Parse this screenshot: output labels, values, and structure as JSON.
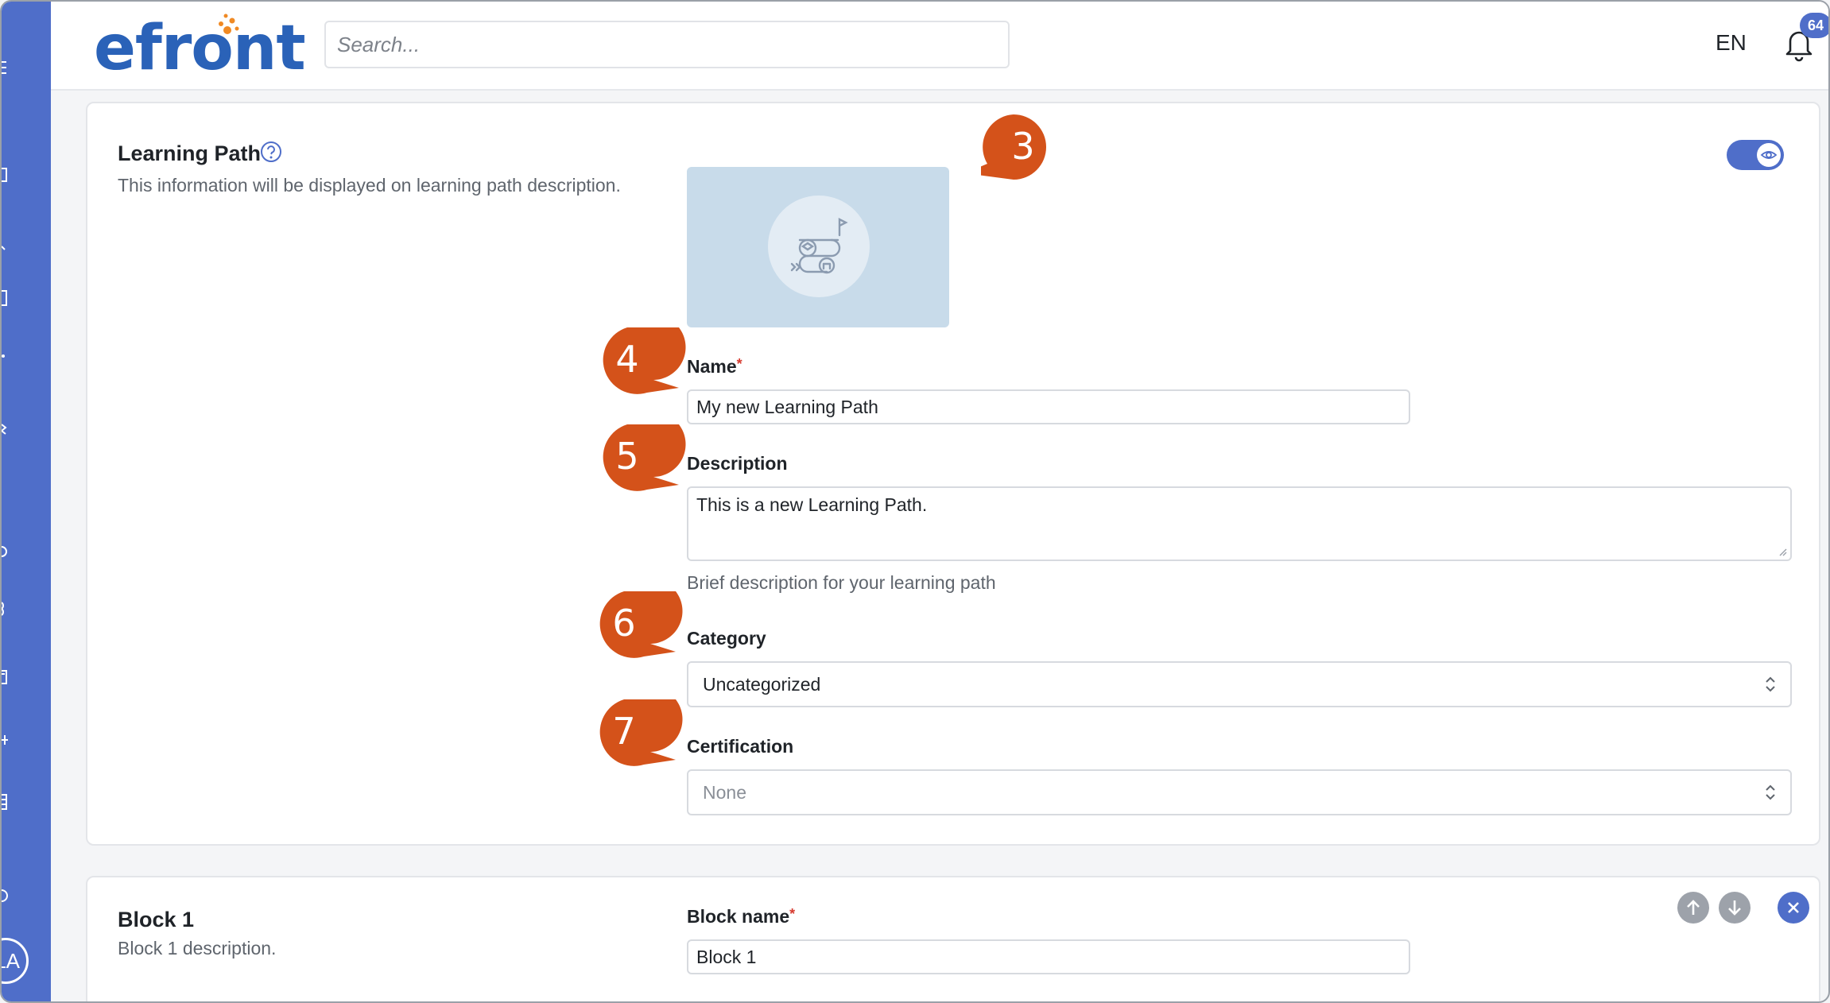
{
  "app": {
    "logo_text": "efront",
    "search_placeholder": "Search...",
    "language": "EN",
    "notification_count": "64",
    "user_initials": "LA"
  },
  "learning_path": {
    "title": "Learning Path",
    "subtitle": "This information will be displayed on learning path description.",
    "visible": true,
    "fields": {
      "name_label": "Name",
      "name_value": "My new Learning Path",
      "description_label": "Description",
      "description_value": "This is a new Learning Path.",
      "description_help": "Brief description for your learning path",
      "category_label": "Category",
      "category_value": "Uncategorized",
      "certification_label": "Certification",
      "certification_value": "None"
    }
  },
  "block": {
    "title": "Block 1",
    "subtitle": "Block 1 description.",
    "name_label": "Block name",
    "name_value": "Block 1"
  },
  "annotations": [
    "3",
    "4",
    "5",
    "6",
    "7"
  ],
  "colors": {
    "sidebar": "#4f6ec9",
    "accent": "#4f6ec9",
    "marker": "#d4521a",
    "logo_blue": "#2a62b8",
    "logo_orange": "#f08a24",
    "required": "#d63a2f"
  },
  "icons": {
    "help": "question-circle-icon",
    "bell": "bell-icon",
    "toggle": "eye-icon",
    "thumbnail": "learning-path-icon",
    "move_up": "arrow-up-icon",
    "move_down": "arrow-down-icon",
    "remove": "close-icon",
    "select": "chevron-up-down-icon"
  }
}
